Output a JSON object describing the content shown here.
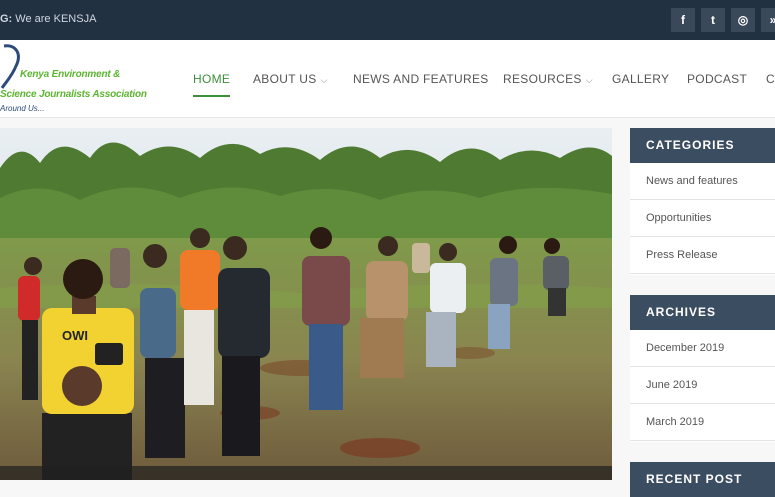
{
  "topbar": {
    "tag_prefix": "G:",
    "tagline": "We are KENSJA",
    "social": [
      {
        "icon": "facebook-icon",
        "glyph": "f"
      },
      {
        "icon": "twitter-icon",
        "glyph": "t"
      },
      {
        "icon": "instagram-icon",
        "glyph": "◎"
      },
      {
        "icon": "more-icon",
        "glyph": "»"
      }
    ]
  },
  "logo": {
    "line1": "Kenya Environment &",
    "line2": "Science Journalists Association",
    "line3": "Around Us..."
  },
  "nav": {
    "items": [
      {
        "label": "HOME",
        "active": true
      },
      {
        "label": "ABOUT US",
        "dropdown": true
      },
      {
        "label": "NEWS AND FEATURES"
      },
      {
        "label": "RESOURCES",
        "dropdown": true
      },
      {
        "label": "GALLERY"
      },
      {
        "label": "PODCAST"
      },
      {
        "label": "C"
      }
    ]
  },
  "hero": {
    "shirt_text": "OWI"
  },
  "sidebar": {
    "categories": {
      "title": "CATEGORIES",
      "items": [
        "News and features",
        "Opportunities",
        "Press Release"
      ]
    },
    "archives": {
      "title": "ARCHIVES",
      "items": [
        "December 2019",
        "June 2019",
        "March 2019"
      ]
    },
    "recent": {
      "title": "RECENT POST"
    }
  },
  "colors": {
    "topbar": "#223142",
    "accent": "#3d8f3a",
    "widget_header": "#3b4d61"
  }
}
